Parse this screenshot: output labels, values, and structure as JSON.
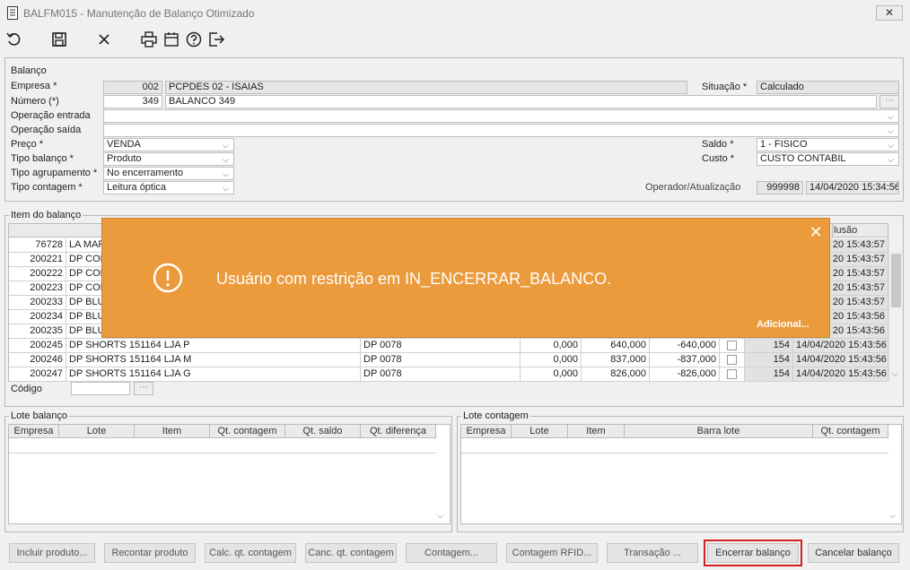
{
  "window": {
    "title": "BALFM015 - Manutenção de Balanço Otimizado",
    "close": "✕"
  },
  "toolbar": {
    "icons": [
      "undo-icon",
      "save-icon",
      "cancel-icon",
      "print-icon",
      "calendar-icon",
      "help-icon",
      "exit-icon"
    ]
  },
  "balanco": {
    "legend": "Balanço",
    "empresa_label": "Empresa *",
    "empresa_code": "002",
    "empresa_name": "PCPDES 02 - ISAIAS",
    "numero_label": "Número (*)",
    "numero_value": "349",
    "numero_desc": "BALANCO 349",
    "op_entrada_label": "Operação entrada",
    "op_saida_label": "Operação saída",
    "preco_label": "Preço *",
    "preco_value": "VENDA",
    "tipo_balanco_label": "Tipo balanço *",
    "tipo_balanco_value": "Produto",
    "tipo_agrup_label": "Tipo agrupamento *",
    "tipo_agrup_value": "No encerramento",
    "tipo_contagem_label": "Tipo contagem *",
    "tipo_contagem_value": "Leitura óptica",
    "situacao_label": "Situação *",
    "situacao_value": "Calculado",
    "saldo_label": "Saldo *",
    "saldo_value": "1 - FISICO",
    "custo_label": "Custo *",
    "custo_value": "CUSTO CONTABIL",
    "operador_label": "Operador/Atualização",
    "operador_value": "999998",
    "atualizacao_value": "14/04/2020 15:34:56"
  },
  "item_balanco": {
    "legend": "Item do balanço",
    "inclusao_header": "lusão",
    "rows": [
      {
        "code": "76728",
        "desc": "LA MAR",
        "ref": "",
        "qt": "",
        "saldo": "",
        "dif": "",
        "op": "",
        "data": "20 15:43:57"
      },
      {
        "code": "200221",
        "desc": "DP CON",
        "ref": "",
        "qt": "",
        "saldo": "",
        "dif": "",
        "op": "",
        "data": "20 15:43:57"
      },
      {
        "code": "200222",
        "desc": "DP CON",
        "ref": "",
        "qt": "",
        "saldo": "",
        "dif": "",
        "op": "",
        "data": "20 15:43:57"
      },
      {
        "code": "200223",
        "desc": "DP CON",
        "ref": "",
        "qt": "",
        "saldo": "",
        "dif": "",
        "op": "",
        "data": "20 15:43:57"
      },
      {
        "code": "200233",
        "desc": "DP BLU",
        "ref": "",
        "qt": "",
        "saldo": "",
        "dif": "",
        "op": "",
        "data": "20 15:43:57"
      },
      {
        "code": "200234",
        "desc": "DP BLU",
        "ref": "",
        "qt": "",
        "saldo": "",
        "dif": "",
        "op": "",
        "data": "20 15:43:56"
      },
      {
        "code": "200235",
        "desc": "DP BLU",
        "ref": "",
        "qt": "",
        "saldo": "",
        "dif": "",
        "op": "",
        "data": "20 15:43:56"
      },
      {
        "code": "200245",
        "desc": "DP SHORTS 151164 LJA P",
        "ref": "DP 0078",
        "qt": "0,000",
        "saldo": "640,000",
        "dif": "-640,000",
        "op": "154",
        "data": "14/04/2020 15:43:56"
      },
      {
        "code": "200246",
        "desc": "DP SHORTS 151164 LJA M",
        "ref": "DP 0078",
        "qt": "0,000",
        "saldo": "837,000",
        "dif": "-837,000",
        "op": "154",
        "data": "14/04/2020 15:43:56"
      },
      {
        "code": "200247",
        "desc": "DP SHORTS 151164 LJA G",
        "ref": "DP 0078",
        "qt": "0,000",
        "saldo": "826,000",
        "dif": "-826,000",
        "op": "154",
        "data": "14/04/2020 15:43:56"
      }
    ],
    "codigo_label": "Código"
  },
  "lote_balanco": {
    "legend": "Lote balanço",
    "headers": [
      "Empresa",
      "Lote",
      "Item",
      "Qt. contagem",
      "Qt. saldo",
      "Qt. diferença"
    ]
  },
  "lote_contagem": {
    "legend": "Lote contagem",
    "headers": [
      "Empresa",
      "Lote",
      "Item",
      "Barra lote",
      "Qt. contagem"
    ]
  },
  "toast": {
    "message": "Usuário com restrição em IN_ENCERRAR_BALANCO.",
    "link": "Adicional...",
    "close": "✕",
    "icon": "!"
  },
  "buttons": {
    "incluir": "Incluir produto...",
    "recontar": "Recontar produto",
    "calc": "Calc. qt. contagem",
    "canc": "Canc. qt. contagem",
    "contagem": "Contagem...",
    "rfid": "Contagem RFID...",
    "transacao": "Transação ...",
    "encerrar": "Encerrar balanço",
    "cancelar": "Cancelar balanço"
  },
  "colors": {
    "toast_bg": "#eb9b3c",
    "highlight_border": "#d02020"
  }
}
